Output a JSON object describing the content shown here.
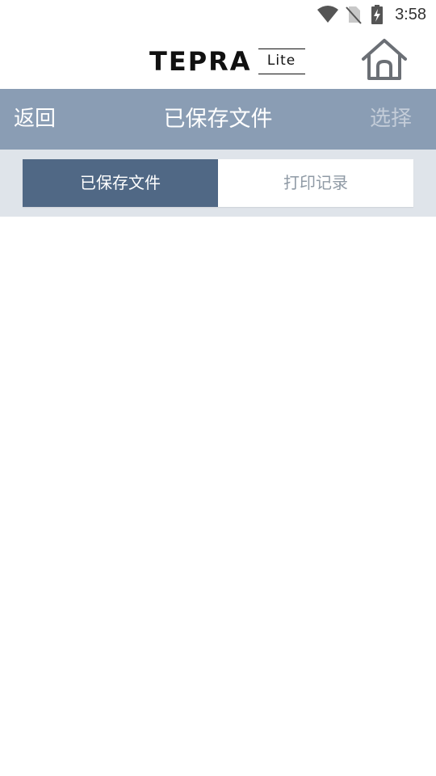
{
  "status_bar": {
    "time": "3:58",
    "icons": [
      "wifi-icon",
      "no-sim-icon",
      "battery-charging-icon"
    ]
  },
  "header": {
    "logo_main": "TEPRA",
    "logo_sub": "Lite",
    "home_icon": "home-icon"
  },
  "nav": {
    "back_label": "返回",
    "title": "已保存文件",
    "select_label": "选择"
  },
  "tabs": [
    {
      "label": "已保存文件",
      "active": true
    },
    {
      "label": "打印记录",
      "active": false
    }
  ],
  "colors": {
    "nav_bar": "#8a9db4",
    "tab_active": "#506885",
    "tab_strip": "#dfe4ea"
  }
}
